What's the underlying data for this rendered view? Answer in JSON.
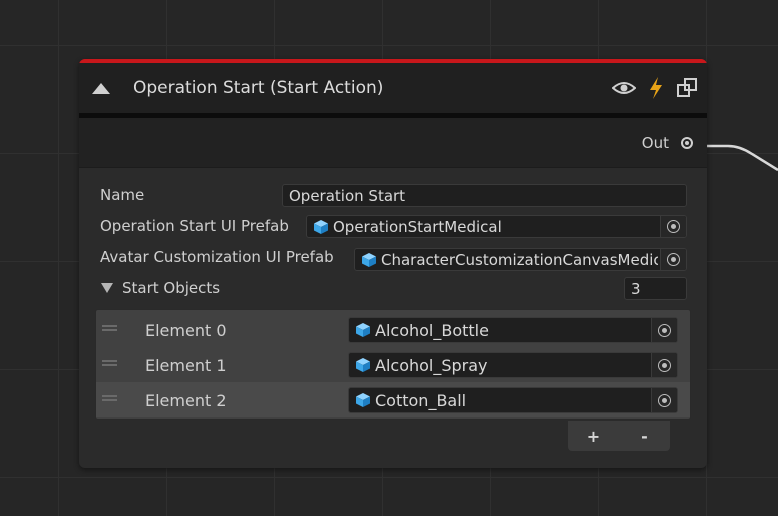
{
  "node": {
    "title": "Operation Start (Start Action)",
    "header_color": "#c8171b",
    "icons": [
      "eye-icon",
      "lightning-icon",
      "prefab-link-icon"
    ],
    "out_label": "Out"
  },
  "fields": {
    "name": {
      "label": "Name",
      "value": "Operation Start"
    },
    "op_prefab": {
      "label": "Operation Start UI Prefab",
      "value": "OperationStartMedical"
    },
    "avatar_prefab": {
      "label": "Avatar Customization UI Prefab",
      "value": "CharacterCustomizationCanvasMedical"
    }
  },
  "start_objects": {
    "label": "Start Objects",
    "count": "3",
    "elements": [
      {
        "label": "Element 0",
        "value": "Alcohol_Bottle"
      },
      {
        "label": "Element 1",
        "value": "Alcohol_Spray"
      },
      {
        "label": "Element 2",
        "value": "Cotton_Ball"
      }
    ],
    "add_label": "+",
    "remove_label": "-"
  }
}
